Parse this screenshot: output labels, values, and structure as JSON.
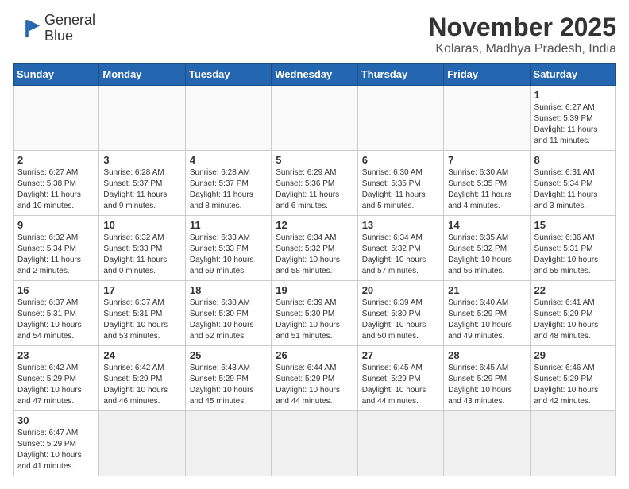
{
  "header": {
    "logo_line1": "General",
    "logo_line2": "Blue",
    "month": "November 2025",
    "location": "Kolaras, Madhya Pradesh, India"
  },
  "days_of_week": [
    "Sunday",
    "Monday",
    "Tuesday",
    "Wednesday",
    "Thursday",
    "Friday",
    "Saturday"
  ],
  "weeks": [
    [
      {
        "day": "",
        "info": ""
      },
      {
        "day": "",
        "info": ""
      },
      {
        "day": "",
        "info": ""
      },
      {
        "day": "",
        "info": ""
      },
      {
        "day": "",
        "info": ""
      },
      {
        "day": "",
        "info": ""
      },
      {
        "day": "1",
        "info": "Sunrise: 6:27 AM\nSunset: 5:39 PM\nDaylight: 11 hours and 11 minutes."
      }
    ],
    [
      {
        "day": "2",
        "info": "Sunrise: 6:27 AM\nSunset: 5:38 PM\nDaylight: 11 hours and 10 minutes."
      },
      {
        "day": "3",
        "info": "Sunrise: 6:28 AM\nSunset: 5:37 PM\nDaylight: 11 hours and 9 minutes."
      },
      {
        "day": "4",
        "info": "Sunrise: 6:28 AM\nSunset: 5:37 PM\nDaylight: 11 hours and 8 minutes."
      },
      {
        "day": "5",
        "info": "Sunrise: 6:29 AM\nSunset: 5:36 PM\nDaylight: 11 hours and 6 minutes."
      },
      {
        "day": "6",
        "info": "Sunrise: 6:30 AM\nSunset: 5:35 PM\nDaylight: 11 hours and 5 minutes."
      },
      {
        "day": "7",
        "info": "Sunrise: 6:30 AM\nSunset: 5:35 PM\nDaylight: 11 hours and 4 minutes."
      },
      {
        "day": "8",
        "info": "Sunrise: 6:31 AM\nSunset: 5:34 PM\nDaylight: 11 hours and 3 minutes."
      }
    ],
    [
      {
        "day": "9",
        "info": "Sunrise: 6:32 AM\nSunset: 5:34 PM\nDaylight: 11 hours and 2 minutes."
      },
      {
        "day": "10",
        "info": "Sunrise: 6:32 AM\nSunset: 5:33 PM\nDaylight: 11 hours and 0 minutes."
      },
      {
        "day": "11",
        "info": "Sunrise: 6:33 AM\nSunset: 5:33 PM\nDaylight: 10 hours and 59 minutes."
      },
      {
        "day": "12",
        "info": "Sunrise: 6:34 AM\nSunset: 5:32 PM\nDaylight: 10 hours and 58 minutes."
      },
      {
        "day": "13",
        "info": "Sunrise: 6:34 AM\nSunset: 5:32 PM\nDaylight: 10 hours and 57 minutes."
      },
      {
        "day": "14",
        "info": "Sunrise: 6:35 AM\nSunset: 5:32 PM\nDaylight: 10 hours and 56 minutes."
      },
      {
        "day": "15",
        "info": "Sunrise: 6:36 AM\nSunset: 5:31 PM\nDaylight: 10 hours and 55 minutes."
      }
    ],
    [
      {
        "day": "16",
        "info": "Sunrise: 6:37 AM\nSunset: 5:31 PM\nDaylight: 10 hours and 54 minutes."
      },
      {
        "day": "17",
        "info": "Sunrise: 6:37 AM\nSunset: 5:31 PM\nDaylight: 10 hours and 53 minutes."
      },
      {
        "day": "18",
        "info": "Sunrise: 6:38 AM\nSunset: 5:30 PM\nDaylight: 10 hours and 52 minutes."
      },
      {
        "day": "19",
        "info": "Sunrise: 6:39 AM\nSunset: 5:30 PM\nDaylight: 10 hours and 51 minutes."
      },
      {
        "day": "20",
        "info": "Sunrise: 6:39 AM\nSunset: 5:30 PM\nDaylight: 10 hours and 50 minutes."
      },
      {
        "day": "21",
        "info": "Sunrise: 6:40 AM\nSunset: 5:29 PM\nDaylight: 10 hours and 49 minutes."
      },
      {
        "day": "22",
        "info": "Sunrise: 6:41 AM\nSunset: 5:29 PM\nDaylight: 10 hours and 48 minutes."
      }
    ],
    [
      {
        "day": "23",
        "info": "Sunrise: 6:42 AM\nSunset: 5:29 PM\nDaylight: 10 hours and 47 minutes."
      },
      {
        "day": "24",
        "info": "Sunrise: 6:42 AM\nSunset: 5:29 PM\nDaylight: 10 hours and 46 minutes."
      },
      {
        "day": "25",
        "info": "Sunrise: 6:43 AM\nSunset: 5:29 PM\nDaylight: 10 hours and 45 minutes."
      },
      {
        "day": "26",
        "info": "Sunrise: 6:44 AM\nSunset: 5:29 PM\nDaylight: 10 hours and 44 minutes."
      },
      {
        "day": "27",
        "info": "Sunrise: 6:45 AM\nSunset: 5:29 PM\nDaylight: 10 hours and 44 minutes."
      },
      {
        "day": "28",
        "info": "Sunrise: 6:45 AM\nSunset: 5:29 PM\nDaylight: 10 hours and 43 minutes."
      },
      {
        "day": "29",
        "info": "Sunrise: 6:46 AM\nSunset: 5:29 PM\nDaylight: 10 hours and 42 minutes."
      }
    ],
    [
      {
        "day": "30",
        "info": "Sunrise: 6:47 AM\nSunset: 5:29 PM\nDaylight: 10 hours and 41 minutes."
      },
      {
        "day": "",
        "info": ""
      },
      {
        "day": "",
        "info": ""
      },
      {
        "day": "",
        "info": ""
      },
      {
        "day": "",
        "info": ""
      },
      {
        "day": "",
        "info": ""
      },
      {
        "day": "",
        "info": ""
      }
    ]
  ]
}
